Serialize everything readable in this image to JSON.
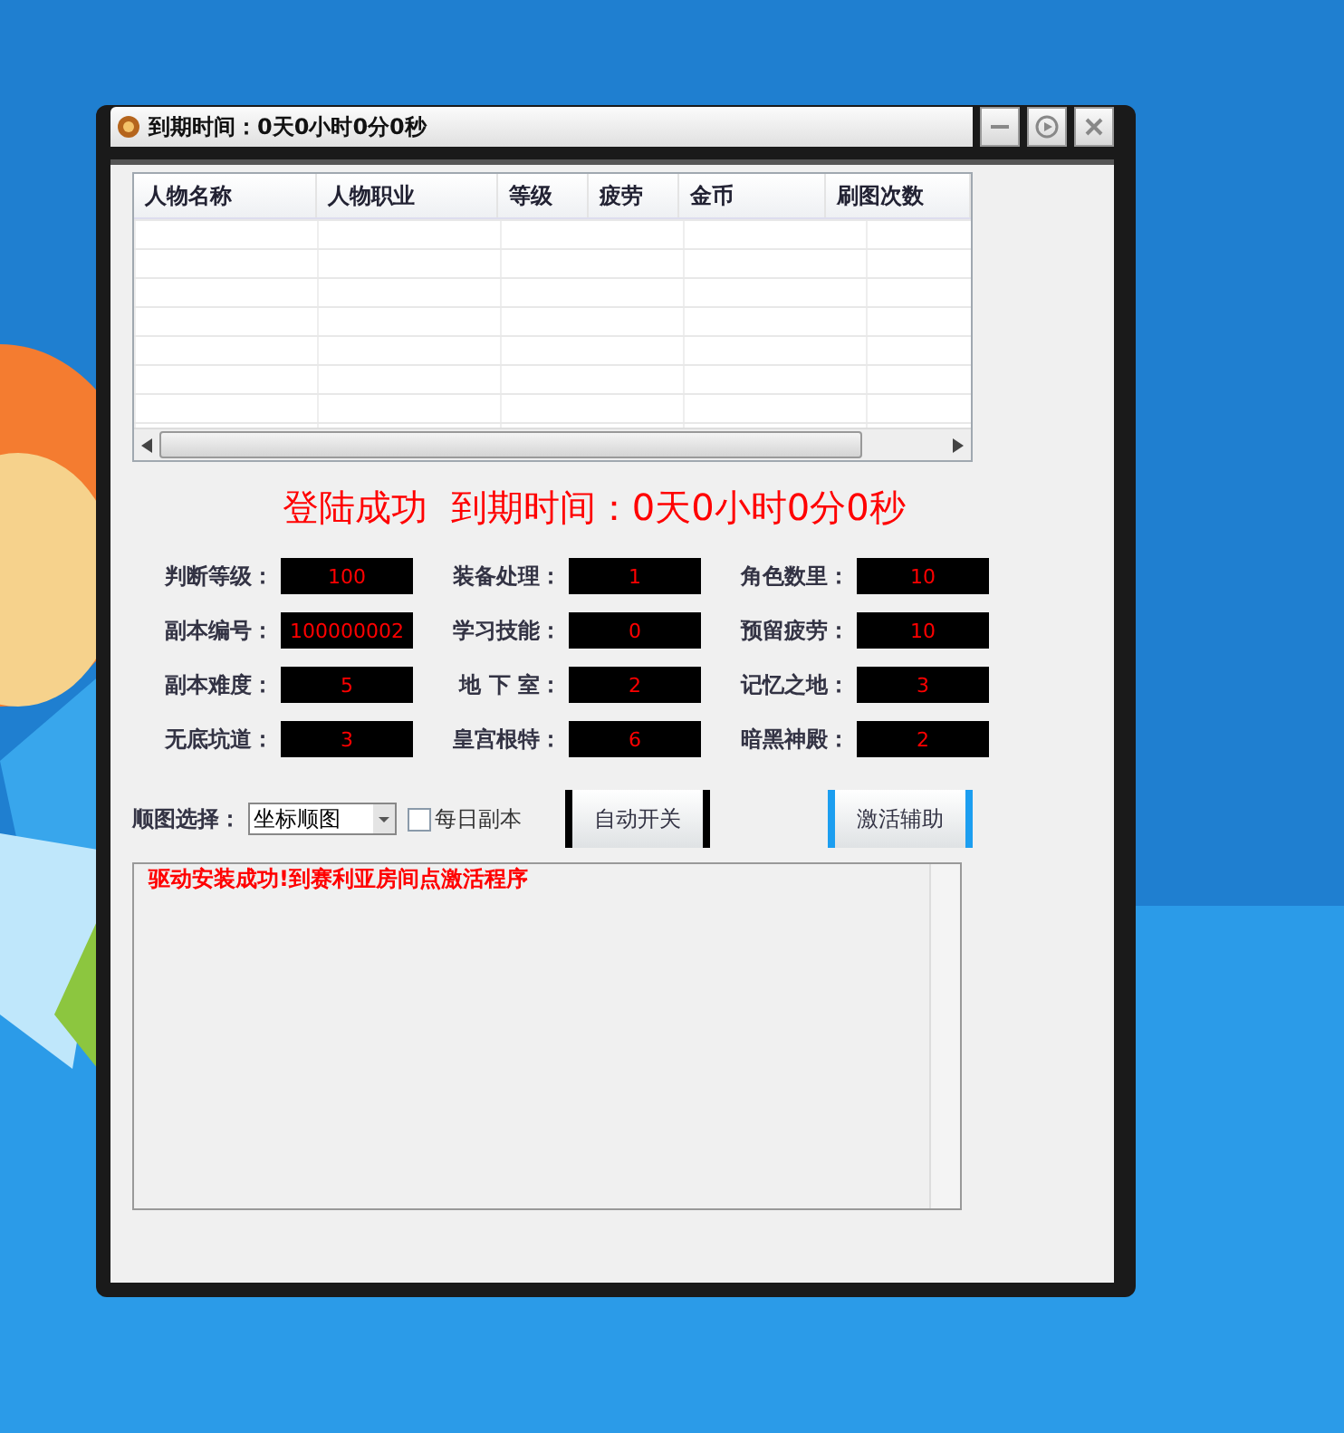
{
  "window": {
    "title": "到期时间：0天0小时0分0秒"
  },
  "table": {
    "columns": [
      "人物名称",
      "人物职业",
      "等级",
      "疲劳",
      "金币",
      "刷图次数"
    ]
  },
  "status": "登陆成功  到期时间：0天0小时0分0秒",
  "fields": [
    {
      "label": "判断等级：",
      "value": "100"
    },
    {
      "label": "装备处理：",
      "value": "1"
    },
    {
      "label": "角色数里：",
      "value": "10"
    },
    {
      "label": "副本编号：",
      "value": "100000002"
    },
    {
      "label": "学习技能：",
      "value": "0"
    },
    {
      "label": "预留疲劳：",
      "value": "10"
    },
    {
      "label": "副本难度：",
      "value": "5"
    },
    {
      "label": "地 下 室：",
      "value": "2"
    },
    {
      "label": "记忆之地：",
      "value": "3"
    },
    {
      "label": "无底坑道：",
      "value": "3"
    },
    {
      "label": "皇宫根特：",
      "value": "6"
    },
    {
      "label": "暗黑神殿：",
      "value": "2"
    }
  ],
  "route": {
    "label": "顺图选择：",
    "value": "坐标顺图"
  },
  "daily": {
    "label": "每日副本",
    "checked": false
  },
  "buttons": [
    {
      "label": "自动开关",
      "color": "#000000"
    },
    {
      "label": "激活辅助",
      "color": "#1c9ef0"
    }
  ],
  "log": [
    "驱动安装成功!到赛利亚房间点激活程序"
  ]
}
